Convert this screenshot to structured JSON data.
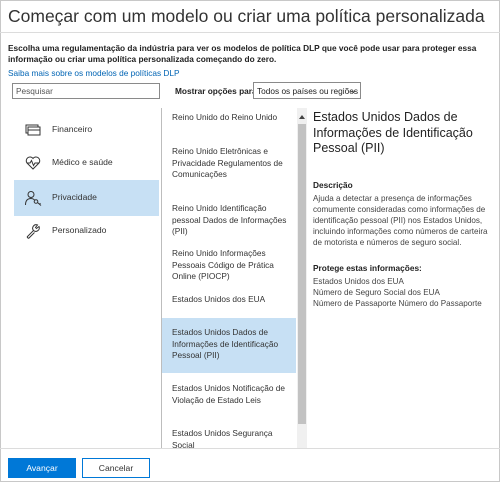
{
  "title": "Começar com um modelo ou criar uma política personalizada",
  "intro": "Escolha uma regulamentação da indústria para ver os modelos de política DLP que você pode usar para proteger essa informação ou criar uma política personalizada começando do zero.",
  "learn_more_link": "Saiba mais sobre os modelos de políticas DLP",
  "search": {
    "placeholder": "Pesquisar"
  },
  "filter": {
    "label": "Mostrar opções para",
    "selected": "Todos os países ou regiões"
  },
  "categories": [
    {
      "label": "Financeiro",
      "icon": "card-icon",
      "selected": false
    },
    {
      "label": "Médico e saúde",
      "icon": "heartbeat-icon",
      "selected": false
    },
    {
      "label": "Privacidade",
      "icon": "person-key-icon",
      "selected": true
    },
    {
      "label": "Personalizado",
      "icon": "wrench-icon",
      "selected": false
    }
  ],
  "templates": [
    {
      "label": "Reino Unido do Reino Unido",
      "selected": false
    },
    {
      "label": "Reino Unido Eletrônicas e Privacidade Regulamentos de Comunicações",
      "selected": false
    },
    {
      "label": "Reino Unido Identificação pessoal Dados de Informações (PII)",
      "selected": false
    },
    {
      "label": "Reino Unido Informações Pessoais Código de Prática Online (PIOCP)",
      "selected": false
    },
    {
      "label": "Estados Unidos dos EUA",
      "selected": false
    },
    {
      "label": "Estados Unidos Dados de Informações de Identificação Pessoal (PII)",
      "selected": true
    },
    {
      "label": "Estados Unidos Notificação de Violação de Estado Leis",
      "selected": false
    },
    {
      "label": "Estados Unidos Segurança Social",
      "selected": false
    }
  ],
  "detail": {
    "title": "Estados Unidos Dados de Informações de Identificação Pessoal (PII)",
    "description_heading": "Descrição",
    "description": "Ajuda a detectar a presença de informações comumente consideradas como informações de identificação pessoal (PII) nos Estados Unidos, incluindo informações como números de carteira de motorista e números de seguro social.",
    "protects_heading": "Protege estas informações:",
    "protects": [
      "Estados Unidos dos EUA",
      "Número de Seguro Social dos EUA",
      "Número de Passaporte Número do Passaporte"
    ]
  },
  "buttons": {
    "next": "Avançar",
    "cancel": "Cancelar"
  },
  "colors": {
    "accent": "#0078d7",
    "selection": "#c7e0f4",
    "link": "#0064b4"
  }
}
